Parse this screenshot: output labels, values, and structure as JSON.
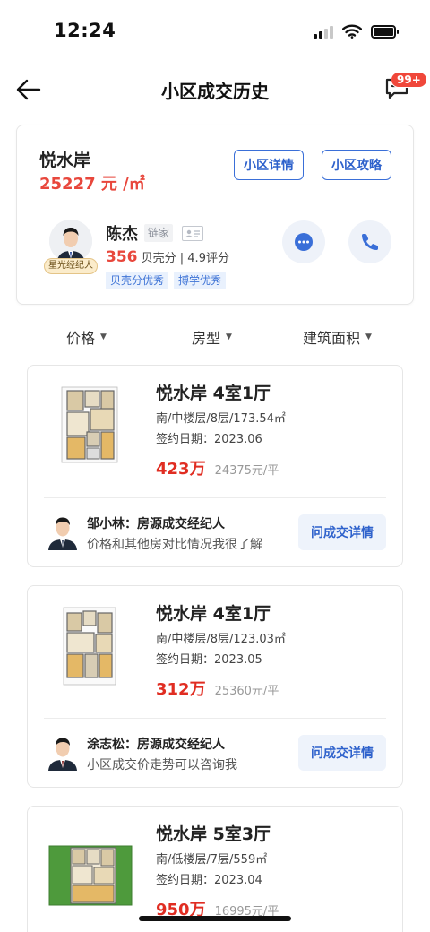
{
  "status": {
    "time": "12:24"
  },
  "header": {
    "title": "小区成交历史",
    "badge": "99+"
  },
  "community": {
    "name": "悦水岸",
    "price": "25227 元 /㎡",
    "detail_button": "小区详情",
    "guide_button": "小区攻略",
    "agent": {
      "name": "陈杰",
      "company": "链家",
      "star_tag": "星光经纪人",
      "score": "356",
      "score_suffix": "贝壳分 | 4.9评分",
      "tags": [
        "贝壳分优秀",
        "搏学优秀"
      ]
    }
  },
  "filters": [
    "价格",
    "房型",
    "建筑面积"
  ],
  "deals": [
    {
      "title": "悦水岸 4室1厅",
      "meta": "南/中楼层/8层/173.54㎡",
      "date": "签约日期：2023.06",
      "total": "423万",
      "unit_price": "24375元/平",
      "agent_line": "邹小林：房源成交经纪人",
      "agent_note": "价格和其他房对比情况我很了解",
      "ask_label": "问成交详情"
    },
    {
      "title": "悦水岸 4室1厅",
      "meta": "南/中楼层/8层/123.03㎡",
      "date": "签约日期：2023.05",
      "total": "312万",
      "unit_price": "25360元/平",
      "agent_line": "涂志松：房源成交经纪人",
      "agent_note": "小区成交价走势可以咨询我",
      "ask_label": "问成交详情"
    },
    {
      "title": "悦水岸 5室3厅",
      "meta": "南/低楼层/7层/559㎡",
      "date": "签约日期：2023.04",
      "total": "950万",
      "unit_price": "16995元/平"
    }
  ],
  "colors": {
    "accent_blue": "#2f62cc",
    "price_red": "#e02d22",
    "badge_red": "#f0473a"
  }
}
